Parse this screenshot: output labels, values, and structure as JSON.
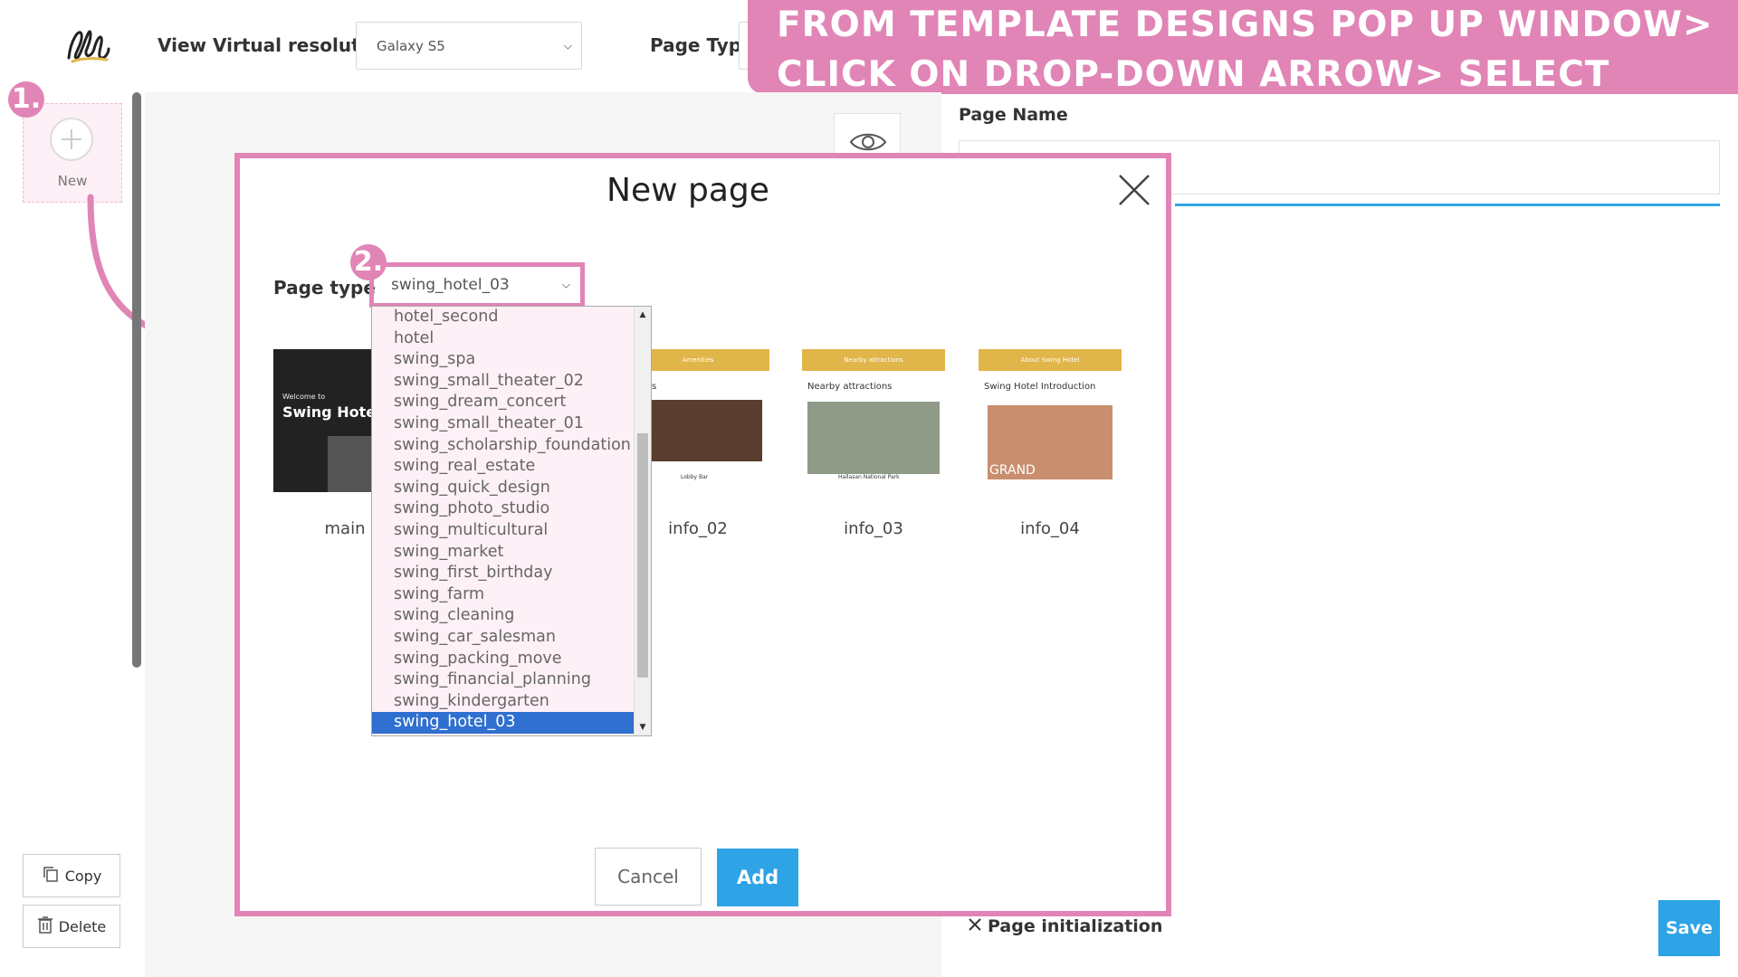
{
  "topbar": {
    "resolution_label": "View Virtual resolution",
    "resolution_value": "Galaxy S5",
    "page_type_label": "Page Type"
  },
  "banner": {
    "text": "From template designs pop up window> click on drop-down arrow> select template category"
  },
  "sidebar": {
    "new_label": "New",
    "copy_label": "Copy",
    "delete_label": "Delete",
    "step1": "1."
  },
  "right_panel": {
    "page_name_label": "Page Name",
    "page_init_label": "Page initialization",
    "save_label": "Save"
  },
  "modal": {
    "title": "New page",
    "page_type_label": "Page type",
    "selected_type": "swing_hotel_03",
    "step2": "2.",
    "dropdown_options": [
      "hotel_second",
      "hotel",
      "swing_spa",
      "swing_small_theater_02",
      "swing_dream_concert",
      "swing_small_theater_01",
      "swing_scholarship_foundation",
      "swing_real_estate",
      "swing_quick_design",
      "swing_photo_studio",
      "swing_multicultural",
      "swing_market",
      "swing_first_birthday",
      "swing_farm",
      "swing_cleaning",
      "swing_car_salesman",
      "swing_packing_move",
      "swing_financial_planning",
      "swing_kindergarten",
      "swing_hotel_03"
    ],
    "templates": [
      {
        "label": "main",
        "caption_small": "Welcome to",
        "caption_big": "Swing Hotel"
      },
      {
        "label": "info_02",
        "header": "Amenities",
        "caption": "nities",
        "sub": "Lobby Bar"
      },
      {
        "label": "info_03",
        "header": "Nearby attractions",
        "caption": "Nearby attractions",
        "sub": "Hallasan National Park"
      },
      {
        "label": "info_04",
        "header": "About Swing Hotel",
        "caption": "Swing Hotel Introduction",
        "sub": "GRAND"
      }
    ],
    "cancel_label": "Cancel",
    "add_label": "Add"
  },
  "colors": {
    "accent_pink": "#e184b6",
    "primary_blue": "#2ea3e6",
    "selected_blue": "#2f6fd0"
  }
}
